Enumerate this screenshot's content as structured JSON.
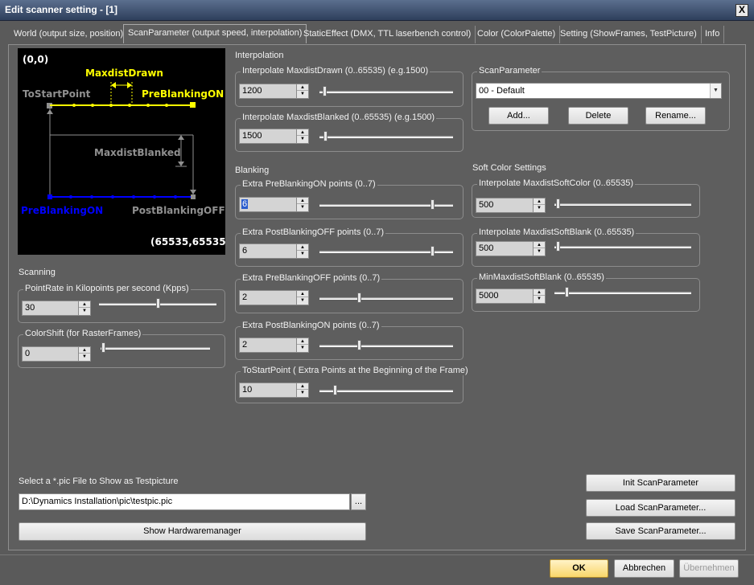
{
  "window": {
    "title": "Edit scanner setting - [1]",
    "close_glyph": "X"
  },
  "tabs": [
    {
      "label": "World (output size, position)"
    },
    {
      "label": "ScanParameter (output speed, interpolation)"
    },
    {
      "label": "StaticEffect (DMX, TTL laserbench control)"
    },
    {
      "label": "Color (ColorPalette)"
    },
    {
      "label": "Setting (ShowFrames, TestPicture)"
    },
    {
      "label": "Info"
    }
  ],
  "diagram": {
    "origin": "(0,0)",
    "maxdist_drawn": "MaxdistDrawn",
    "to_start_point": "ToStartPoint",
    "preblanking_on_top": "PreBlankingON",
    "maxdist_blanked": "MaxdistBlanked",
    "preblanking_on_bottom": "PreBlankingON",
    "postblanking_off": "PostBlankingOFF",
    "max_corner": "(65535,65535)",
    "colors": {
      "yellow": "#ffff00",
      "blue": "#0000ff",
      "gray": "#909090"
    }
  },
  "interpolation": {
    "heading": "Interpolation",
    "maxdist_drawn": {
      "legend": "Interpolate MaxdistDrawn (0..65535) (e.g.1500)",
      "value": "1200",
      "level": 0.018
    },
    "maxdist_blanked": {
      "legend": "Interpolate MaxdistBlanked (0..65535) (e.g.1500)",
      "value": "1500",
      "level": 0.023
    }
  },
  "scan_parameter": {
    "legend": "ScanParameter",
    "selected": "00 - Default",
    "add_label": "Add...",
    "delete_label": "Delete",
    "rename_label": "Rename..."
  },
  "blanking": {
    "heading": "Blanking",
    "extra_preblanking_on": {
      "legend": "Extra PreBlankingON points (0..7)",
      "value": "6",
      "level": 0.857
    },
    "extra_postblanking_off": {
      "legend": "Extra PostBlankingOFF points (0..7)",
      "value": "6",
      "level": 0.857
    },
    "extra_preblanking_off": {
      "legend": "Extra PreBlankingOFF points (0..7)",
      "value": "2",
      "level": 0.286
    },
    "extra_postblanking_on": {
      "legend": "Extra PostBlankingON points (0..7)",
      "value": "2",
      "level": 0.286
    },
    "to_start_point": {
      "legend": "ToStartPoint ( Extra Points at the Beginning of the Frame)",
      "value": "10",
      "level": 0.1
    }
  },
  "soft_color": {
    "heading": "Soft Color Settings",
    "maxdist_soft_color": {
      "legend": "Interpolate MaxdistSoftColor (0..65535)",
      "value": "500",
      "level": 0.008
    },
    "maxdist_soft_blank": {
      "legend": "Interpolate MaxdistSoftBlank (0..65535)",
      "value": "500",
      "level": 0.008
    },
    "min_maxdist_soft_blank": {
      "legend": "MinMaxdistSoftBlank (0..65535)",
      "value": "5000",
      "level": 0.076
    }
  },
  "scanning": {
    "heading": "Scanning",
    "point_rate": {
      "legend": "PointRate in Kilopoints per second (Kpps)",
      "value": "30",
      "level": 0.5
    },
    "color_shift": {
      "legend": "ColorShift (for RasterFrames)",
      "value": "0",
      "level": 0.0
    }
  },
  "testpicture": {
    "label": "Select a *.pic File to Show as Testpicture",
    "path": "D:\\Dynamics Installation\\pic\\testpic.pic",
    "browse_label": "...",
    "hardwaremanager_label": "Show Hardwaremanager"
  },
  "actions": {
    "init_label": "Init ScanParameter",
    "load_label": "Load ScanParameter...",
    "save_label": "Save ScanParameter..."
  },
  "dialog_buttons": {
    "ok_label": "OK",
    "cancel_label": "Abbrechen",
    "apply_label": "Übernehmen"
  }
}
